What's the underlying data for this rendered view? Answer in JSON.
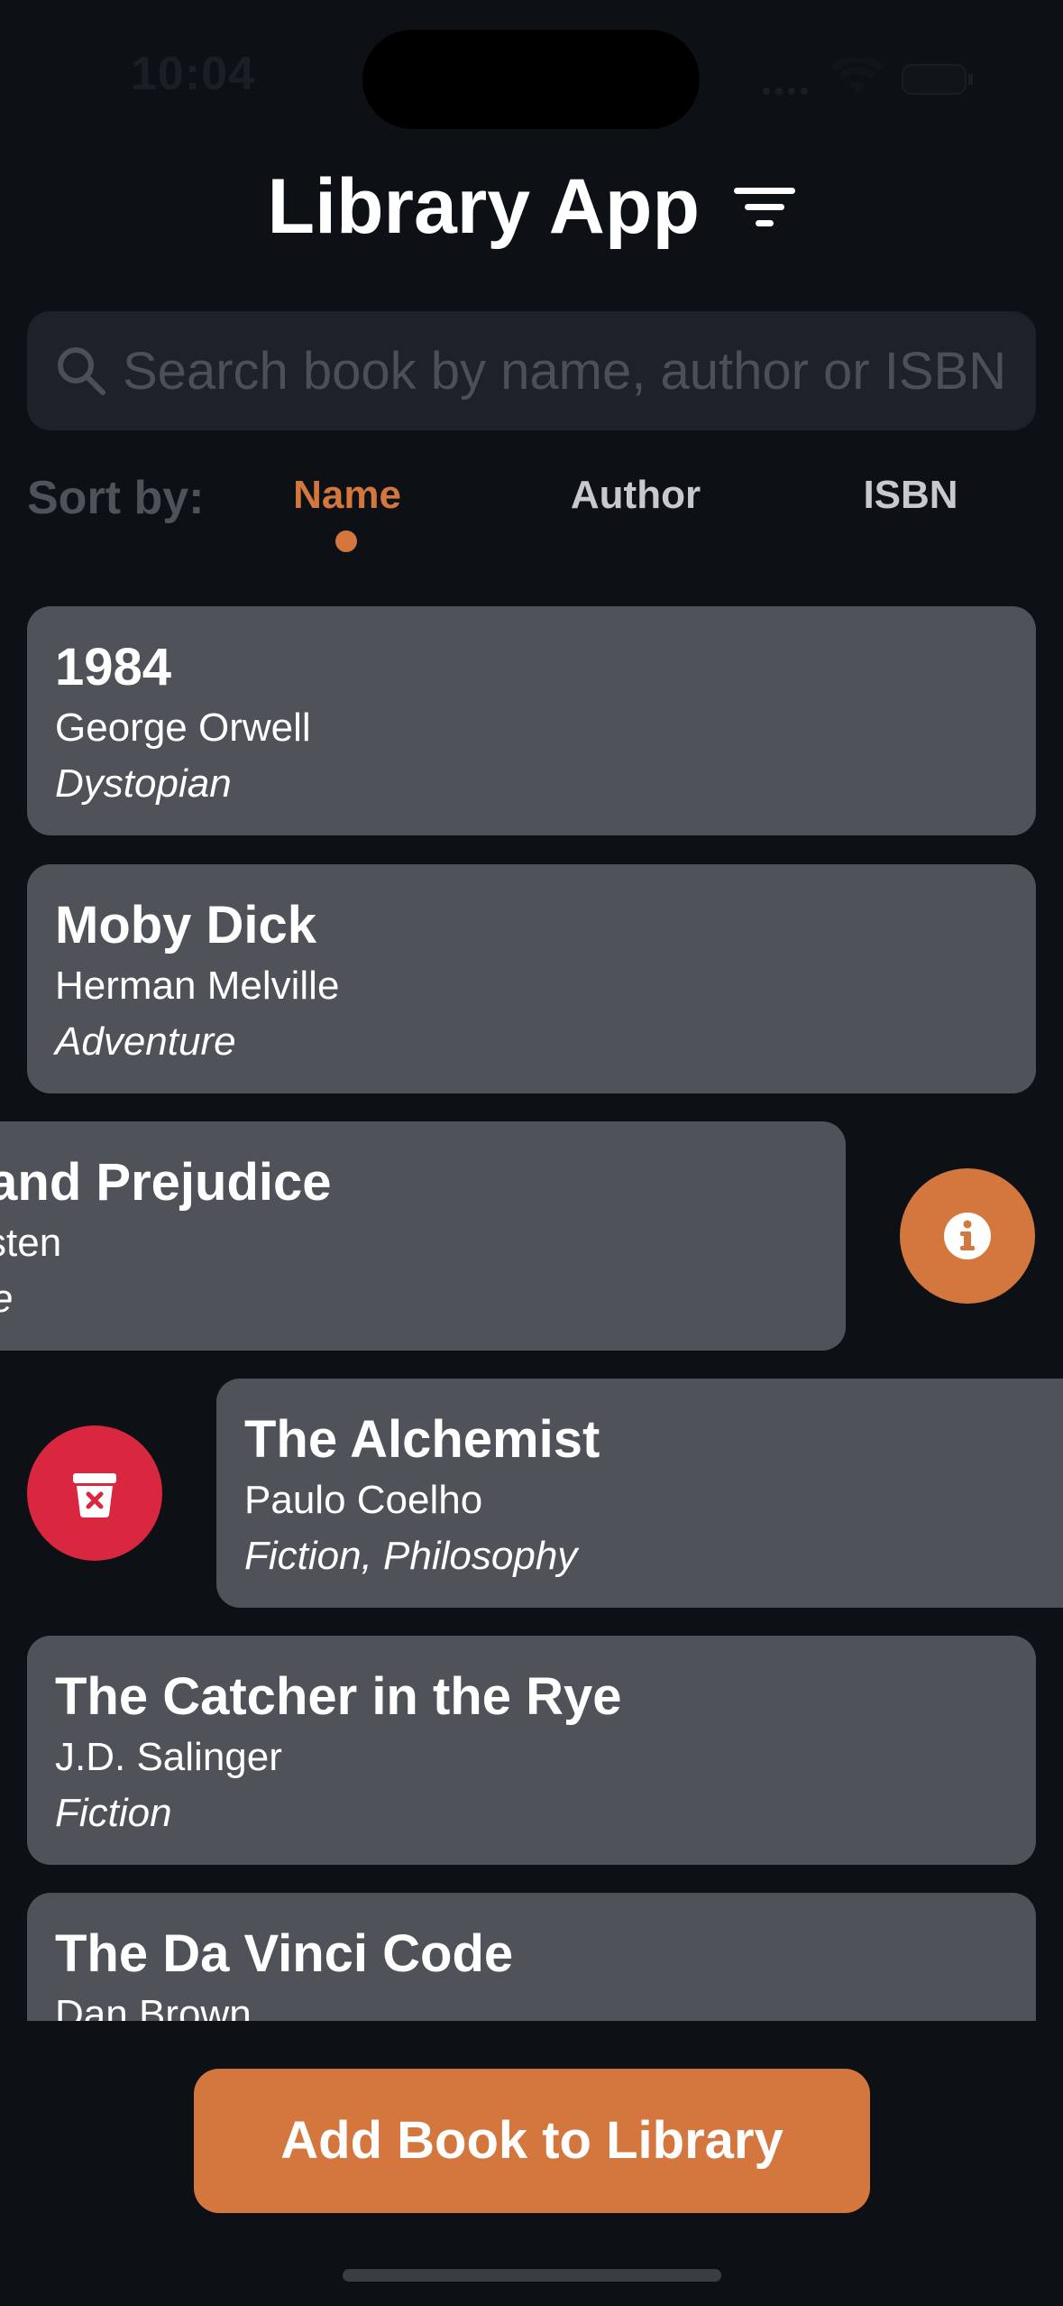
{
  "status_bar": {
    "time": "10:04"
  },
  "header": {
    "title": "Library App",
    "filter_icon": "filter-icon"
  },
  "search": {
    "placeholder": "Search book by name, author or ISBN",
    "value": ""
  },
  "sort": {
    "label": "Sort by:",
    "options": [
      "Name",
      "Author",
      "ISBN"
    ],
    "selected": "Name"
  },
  "books": [
    {
      "title": "1984",
      "author": "George Orwell",
      "genre": "Dystopian"
    },
    {
      "title": "Moby Dick",
      "author": "Herman Melville",
      "genre": "Adventure"
    },
    {
      "title": "Pride and Prejudice",
      "author": "Jane Austen",
      "genre": "Romance"
    },
    {
      "title": "The Alchemist",
      "author": "Paulo Coelho",
      "genre": "Fiction, Philosophy"
    },
    {
      "title": "The Catcher in the Rye",
      "author": "J.D. Salinger",
      "genre": "Fiction"
    },
    {
      "title": "The Da Vinci Code",
      "author": "Dan Brown",
      "genre": ""
    }
  ],
  "actions": {
    "add_button_label": "Add Book to Library"
  },
  "colors": {
    "background": "#0d1116",
    "accent": "#d4773f",
    "danger": "#d9273f",
    "card": "#4f5258"
  }
}
